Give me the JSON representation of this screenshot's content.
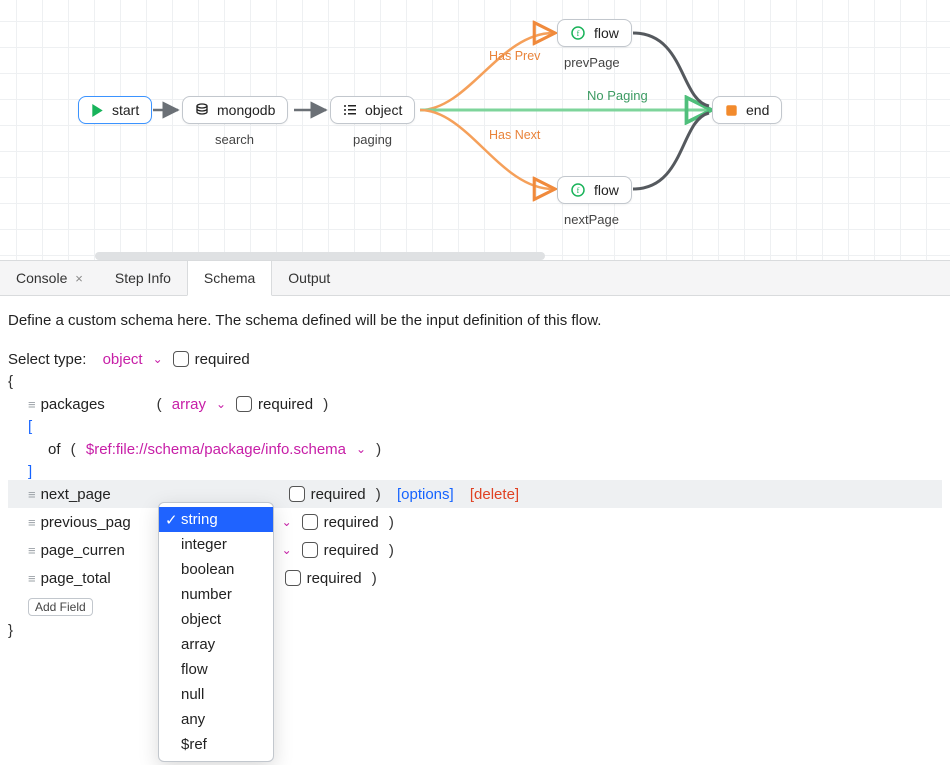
{
  "canvas": {
    "nodes": {
      "start": {
        "label": "start"
      },
      "mongodb": {
        "label": "mongodb",
        "sub": "search"
      },
      "object": {
        "label": "object",
        "sub": "paging"
      },
      "flow1": {
        "label": "flow",
        "sub": "prevPage"
      },
      "flow2": {
        "label": "flow",
        "sub": "nextPage"
      },
      "end": {
        "label": "end"
      }
    },
    "edge_labels": {
      "has_prev": "Has Prev",
      "no_paging": "No Paging",
      "has_next": "Has Next"
    }
  },
  "tabs": {
    "console": "Console",
    "step_info": "Step Info",
    "schema": "Schema",
    "output": "Output"
  },
  "schema": {
    "description": "Define a custom schema here. The schema defined will be the input definition of this flow.",
    "select_type_label": "Select type:",
    "root_type": "object",
    "required_label": "required",
    "fields": {
      "packages": {
        "name": "packages",
        "type": "array"
      },
      "packages_of": {
        "of_label": "of",
        "ref": "$ref:file://schema/package/info.schema"
      },
      "next_page": {
        "name": "next_page"
      },
      "previous_page": {
        "name": "previous_pag"
      },
      "page_current": {
        "name": "page_curren"
      },
      "page_total": {
        "name": "page_total"
      }
    },
    "options_label": "[options]",
    "delete_label": "[delete]",
    "add_field_label": "Add Field"
  },
  "type_dropdown": {
    "selected": "string",
    "options": [
      "string",
      "integer",
      "boolean",
      "number",
      "object",
      "array",
      "flow",
      "null",
      "any",
      "$ref"
    ]
  }
}
